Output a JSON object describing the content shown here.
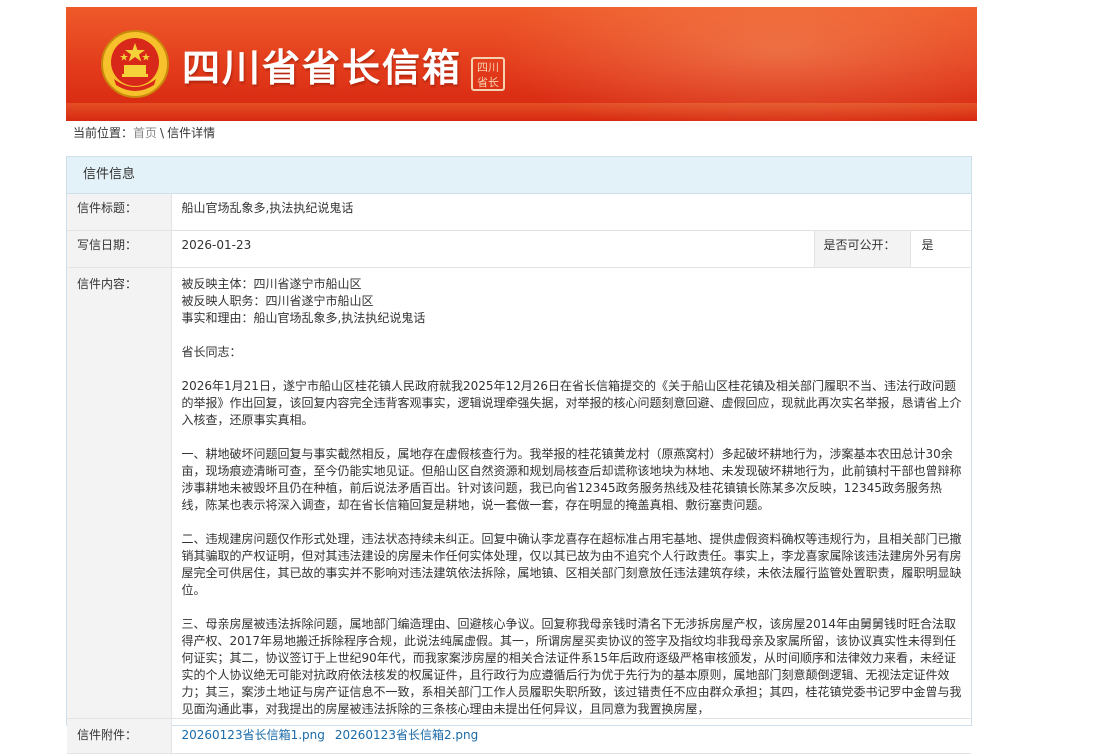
{
  "banner": {
    "title": "四川省省长信箱",
    "seal_text": "四川省长"
  },
  "breadcrumb": {
    "prefix": "当前位置：",
    "home": "首页",
    "separator": "\\",
    "current": "信件详情"
  },
  "panel": {
    "heading": "信件信息"
  },
  "fields": {
    "title_label": "信件标题：",
    "title_value": "船山官场乱象多,执法执纪说鬼话",
    "date_label": "写信日期：",
    "date_value": "2026-01-23",
    "public_label": "是否可公开：",
    "public_value": "是",
    "content_label": "信件内容：",
    "attachment_label": "信件附件："
  },
  "content": {
    "line1": "被反映主体：四川省遂宁市船山区",
    "line2": "被反映人职务：四川省遂宁市船山区",
    "line3": "事实和理由：船山官场乱象多,执法执纪说鬼话",
    "greeting": "省长同志：",
    "para1": "2026年1月21日，遂宁市船山区桂花镇人民政府就我2025年12月26日在省长信箱提交的《关于船山区桂花镇及相关部门履职不当、违法行政问题的举报》作出回复，该回复内容完全违背客观事实，逻辑说理牵强失据，对举报的核心问题刻意回避、虚假回应，现就此再次实名举报，恳请省上介入核查，还原事实真相。",
    "para2": "一、耕地破坏问题回复与事实截然相反，属地存在虚假核查行为。我举报的桂花镇黄龙村（原燕窝村）多起破坏耕地行为，涉案基本农田总计30余亩，现场痕迹清晰可查，至今仍能实地见证。但船山区自然资源和规划局核查后却谎称该地块为林地、未发现破坏耕地行为，此前镇村干部也曾辩称涉事耕地未被毁坏且仍在种植，前后说法矛盾百出。针对该问题，我已向省12345政务服务热线及桂花镇镇长陈某多次反映，12345政务服务热线，陈某也表示将深入调查，却在省长信箱回复是耕地，说一套做一套，存在明显的掩盖真相、敷衍塞责问题。",
    "para3": "二、违规建房问题仅作形式处理，违法状态持续未纠正。回复中确认李龙喜存在超标准占用宅基地、提供虚假资料确权等违规行为，且相关部门已撤销其骗取的产权证明，但对其违法建设的房屋未作任何实体处理，仅以其已故为由不追究个人行政责任。事实上，李龙喜家属除该违法建房外另有房屋完全可供居住，其已故的事实并不影响对违法建筑依法拆除，属地镇、区相关部门刻意放任违法建筑存续，未依法履行监管处置职责，履职明显缺位。",
    "para4": "三、母亲房屋被违法拆除问题，属地部门编造理由、回避核心争议。回复称我母亲钱时清名下无涉拆房屋产权，该房屋2014年由舅舅钱时旺合法取得产权、2017年易地搬迁拆除程序合规，此说法纯属虚假。其一，所谓房屋买卖协议的签字及指纹均非我母亲及家属所留，该协议真实性未得到任何证实；其二，协议签订于上世纪90年代，而我家案涉房屋的相关合法证件系15年后政府逐级严格审核颁发，从时间顺序和法律效力来看，未经证实的个人协议绝无可能对抗政府依法核发的权属证件，且行政行为应遵循后行为优于先行为的基本原则，属地部门刻意颠倒逻辑、无视法定证件效力；其三，案涉土地证与房产证信息不一致，系相关部门工作人员履职失职所致，该过错责任不应由群众承担；其四，桂花镇党委书记罗中金曾与我见面沟通此事，对我提出的房屋被违法拆除的三条核心理由未提出任何异议，且同意为我置换房屋，"
  },
  "attachments": [
    "20260123省长信箱1.png",
    "20260123省长信箱2.png"
  ],
  "colors": {
    "banner_red": "#e23a1b",
    "panel_header_bg": "#e3f1f8",
    "label_bg": "#f3f3f3",
    "link_blue": "#1a6aa8"
  }
}
